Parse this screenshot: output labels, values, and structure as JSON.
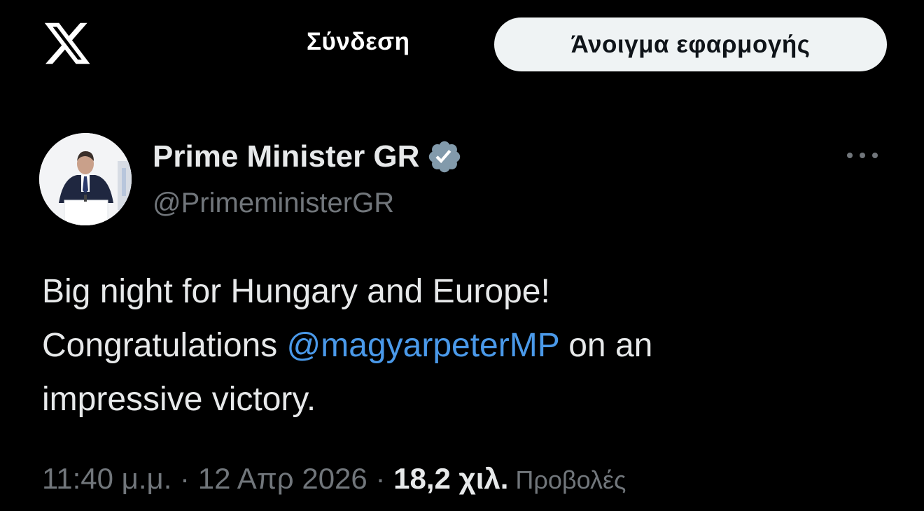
{
  "header": {
    "logo_icon": "x-logo-icon",
    "login_label": "Σύνδεση",
    "open_app_label": "Άνοιγμα εφαρμογής"
  },
  "tweet": {
    "avatar_icon": "avatar",
    "display_name": "Prime Minister GR",
    "verified_icon": "verified-badge-icon",
    "handle": "@PrimeministerGR",
    "more_icon": "more-options-icon",
    "text": {
      "line1": "Big night for Hungary and Europe!",
      "line2_before": "Congratulations ",
      "mention": "@magyarpeterMP",
      "line2_after": " on an",
      "line3": "impressive victory."
    },
    "meta": {
      "time": "11:40 μ.μ.",
      "separator1": " · ",
      "date": "12 Απρ 2026",
      "separator2": " · ",
      "views_count": "18,2 χιλ.",
      "views_label": " Προβολές"
    }
  },
  "colors": {
    "background": "#000000",
    "text_primary": "#e7e9ea",
    "text_secondary": "#71767b",
    "link": "#4a99e9",
    "button_bg": "#eff3f4",
    "verified_badge": "#829aab"
  }
}
